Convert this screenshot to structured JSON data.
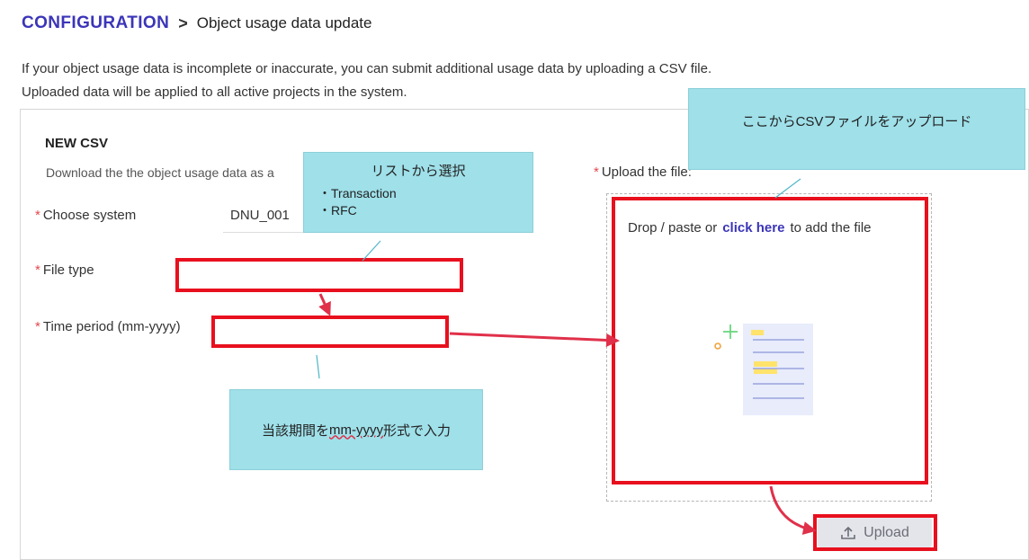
{
  "breadcrumb": {
    "root": "CONFIGURATION",
    "separator": ">",
    "page": "Object usage data update"
  },
  "intro": {
    "line1": "If your object usage data is incomplete or inaccurate, you can submit additional usage data by uploading a CSV file.",
    "line2": "Uploaded data will be applied to all active projects in the system."
  },
  "section": {
    "title": "NEW CSV",
    "description": "Download the the object usage data as a"
  },
  "form": {
    "required_mark": "*",
    "system_label": "Choose system",
    "system_value": "DNU_001",
    "filetype_label": "File type",
    "filetype_value": "",
    "period_label": "Time period (mm-yyyy)",
    "period_value": "",
    "upload_label": "Upload the file:"
  },
  "dropzone": {
    "text_before": "Drop / paste or",
    "link": "click here",
    "text_after": "to add the file"
  },
  "upload_button": {
    "label": "Upload"
  },
  "callouts": {
    "list": {
      "title": "リストから選択",
      "items": [
        "・Transaction",
        "・RFC"
      ]
    },
    "period": {
      "text_before": "当該期間を",
      "format": "mm-yyyy",
      "text_after": "形式で入力"
    },
    "upload": {
      "text": "ここからCSVファイルをアップロード"
    }
  },
  "colors": {
    "brand": "#3b35b8",
    "annotation_red": "#e8101e",
    "arrow": "#e0304a",
    "callout_bg": "#9fe0e9",
    "required": "#e5484d"
  }
}
